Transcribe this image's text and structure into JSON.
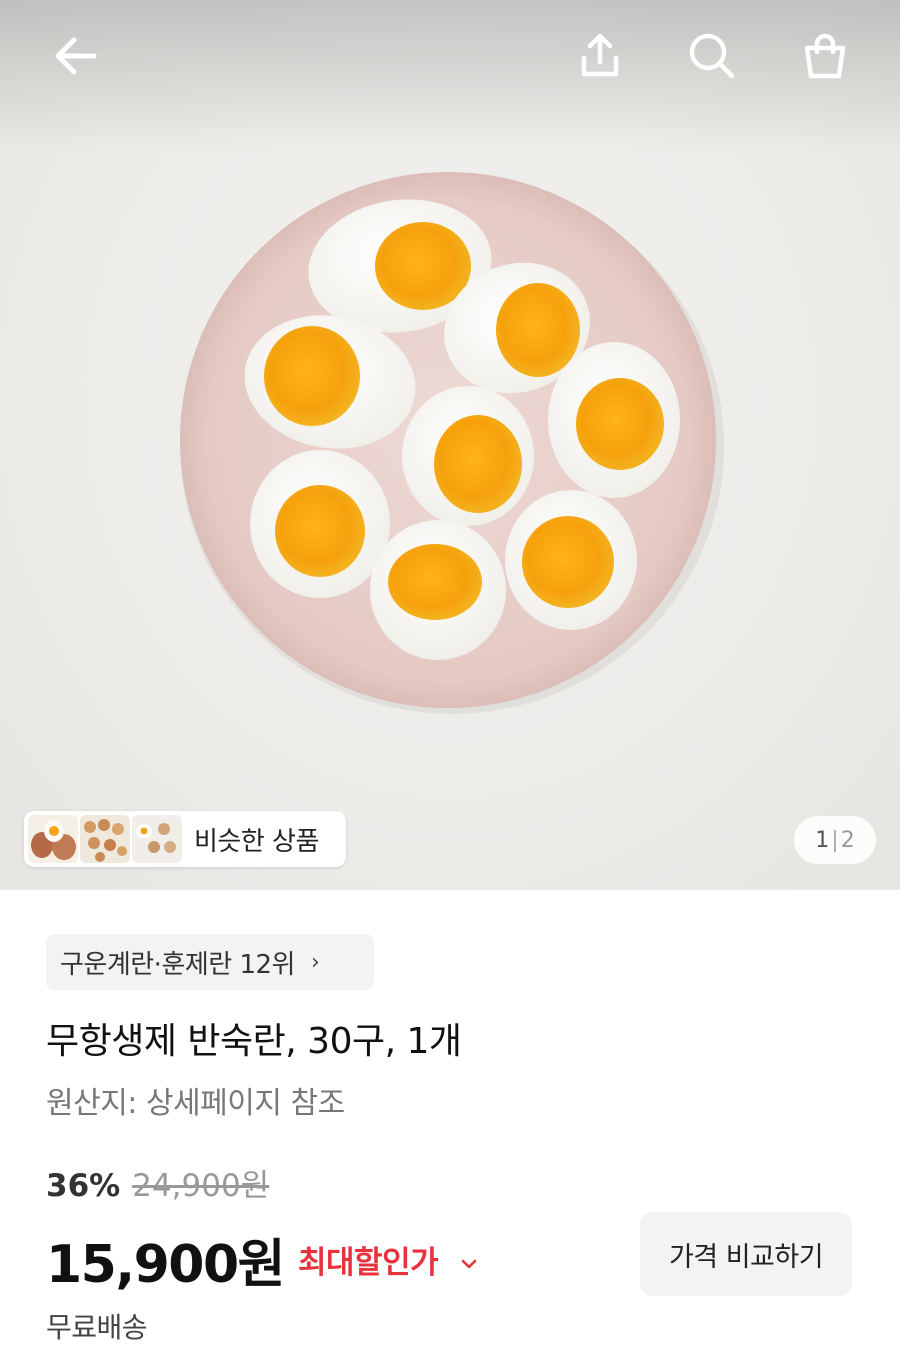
{
  "header": {
    "back_icon": "arrow-left-icon",
    "share_icon": "share-upload-icon",
    "search_icon": "search-icon",
    "cart_icon": "shopping-bag-icon"
  },
  "gallery": {
    "similar_label": "비슷한 상품",
    "page_current": "1",
    "page_separator": "|",
    "page_total": "2"
  },
  "product": {
    "rank_badge": "구운계란·훈제란 12위",
    "rank_chevron": "›",
    "title": "무항생제 반숙란, 30구, 1개",
    "origin": "원산지: 상세페이지 참조",
    "discount_rate": "36%",
    "original_price": "24,900원",
    "price": "15,900원",
    "best_price_label": "최대할인가",
    "compare_button": "가격 비교하기",
    "shipping": "무료배송"
  },
  "colors": {
    "accent_red": "#e8333f",
    "chip_bg": "#f2f3f5"
  }
}
